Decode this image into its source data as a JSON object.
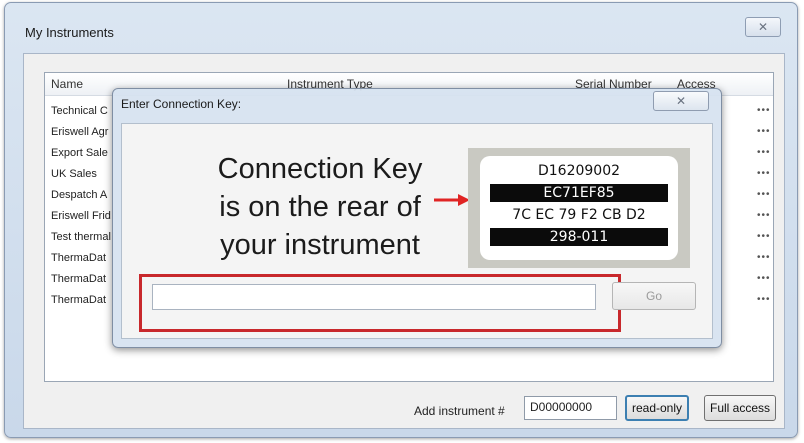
{
  "window": {
    "title": "My Instruments",
    "close_glyph": "✕"
  },
  "list": {
    "columns": [
      "Name",
      "Instrument Type",
      "Serial Number",
      "Access"
    ],
    "rows": [
      {
        "name": "Technical C",
        "more": "•••"
      },
      {
        "name": "Eriswell Agr",
        "more": "•••"
      },
      {
        "name": "Export Sale",
        "more": "•••"
      },
      {
        "name": "UK Sales",
        "more": "•••"
      },
      {
        "name": "Despatch A",
        "more": "•••"
      },
      {
        "name": "Eriswell Frid",
        "more": "•••"
      },
      {
        "name": "Test thermal",
        "more": "•••"
      },
      {
        "name": "ThermaDat",
        "more": "•••"
      },
      {
        "name": "ThermaDat",
        "more": "•••"
      },
      {
        "name": "ThermaDat",
        "more": "•••"
      }
    ]
  },
  "footer": {
    "add_label": "Add instrument #",
    "instrument_value": "D00000000",
    "readonly_label": "read-only",
    "full_access_label": "Full access"
  },
  "dialog": {
    "title": "Enter Connection Key:",
    "close_glyph": "✕",
    "instruction_lines": [
      "Connection Key",
      "is on the rear of",
      "your instrument"
    ],
    "label_lines": [
      "D16209002",
      "EC71EF85",
      "7C EC 79 F2 CB D2",
      "298-011"
    ],
    "key_value": "",
    "go_label": "Go"
  },
  "colors": {
    "highlight": "#c8282c",
    "arrow": "#e02424"
  }
}
